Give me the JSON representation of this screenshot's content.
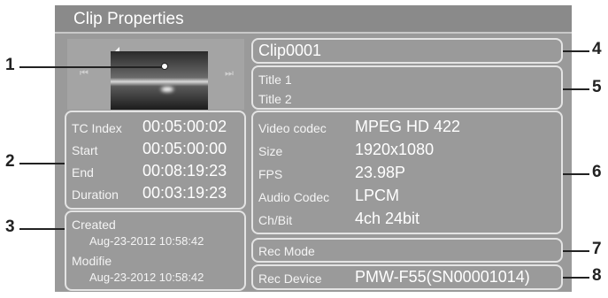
{
  "window": {
    "title": "Clip Properties"
  },
  "thumbnail": {
    "prev_icon": "skip-previous",
    "next_icon": "skip-next"
  },
  "timecodes": [
    {
      "label": "TC Index",
      "value": "00:05:00:02"
    },
    {
      "label": "Start",
      "value": "00:05:00:00"
    },
    {
      "label": "End",
      "value": "00:08:19:23"
    },
    {
      "label": "Duration",
      "value": "00:03:19:23"
    }
  ],
  "dates": {
    "created_label": "Created",
    "created_value": "Aug-23-2012 10:58:42",
    "modified_label": "Modifie",
    "modified_value": "Aug-23-2012 10:58:42"
  },
  "clip_name": "Clip0001",
  "titles": {
    "title1": "Title 1",
    "title2": "Title 2"
  },
  "specs": [
    {
      "label": "Video codec",
      "value": "MPEG HD 422"
    },
    {
      "label": "Size",
      "value": "1920x1080"
    },
    {
      "label": "FPS",
      "value": "23.98P"
    },
    {
      "label": "Audio Codec",
      "value": "LPCM"
    },
    {
      "label": "Ch/Bit",
      "value": "4ch 24bit"
    }
  ],
  "rec_mode": {
    "label": "Rec Mode",
    "value": ""
  },
  "rec_device": {
    "label": "Rec Device",
    "value": "PMW-F55(SN00001014)"
  },
  "callouts": [
    "1",
    "2",
    "3",
    "4",
    "5",
    "6",
    "7",
    "8"
  ]
}
